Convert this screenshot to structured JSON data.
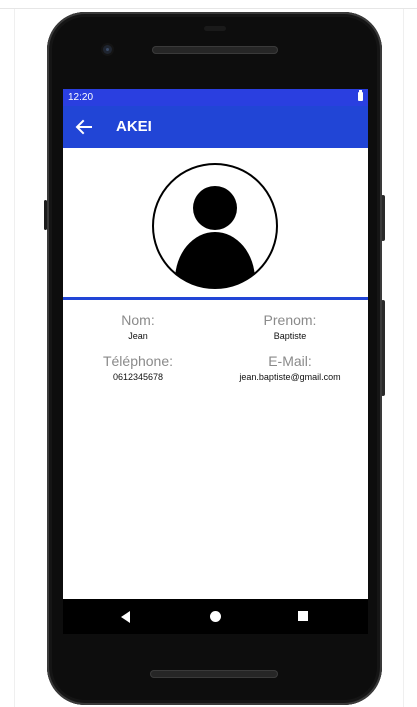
{
  "status_bar": {
    "time": "12:20",
    "battery_icon": "battery-full-icon"
  },
  "app_bar": {
    "back_icon": "arrow-left-icon",
    "title": "AKEI",
    "color": "#2145d6"
  },
  "profile": {
    "avatar_icon": "user-avatar-icon",
    "fields": [
      {
        "label": "Nom:",
        "value": "Jean"
      },
      {
        "label": "Prenom:",
        "value": "Baptiste"
      },
      {
        "label": "Téléphone:",
        "value": "0612345678"
      },
      {
        "label": "E-Mail:",
        "value": "jean.baptiste@gmail.com"
      }
    ]
  },
  "nav_bar": {
    "back_icon": "nav-back-triangle-icon",
    "home_icon": "nav-home-circle-icon",
    "recents_icon": "nav-recents-square-icon"
  },
  "colors": {
    "status_bar": "#2a3fe0",
    "accent": "#2145d6",
    "label_gray": "#8a8a8a"
  }
}
